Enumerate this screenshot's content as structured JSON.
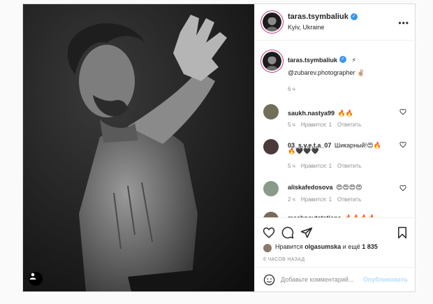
{
  "post": {
    "username": "taras.tsymbaliuk",
    "location": "Kyiv, Ukraine",
    "caption": {
      "username": "taras.tsymbaliuk",
      "emoji": "⚡",
      "text": "@zubarev.photographer ✌🏼",
      "time": "6 ч"
    },
    "comments": [
      {
        "username": "saukh.nastya99",
        "text": "🔥🔥",
        "time": "5 ч",
        "likes": "Нравится: 1",
        "reply": "Ответить"
      },
      {
        "username": "03_s.v.e.t.a_07",
        "text": "Шикарный!😍🔥",
        "text2": "🔥🖤🖤🖤",
        "time": "5 ч",
        "likes": "Нравится: 1",
        "reply": "Ответить"
      },
      {
        "username": "aliskafedosova",
        "text": "😍😍😍😍",
        "time": "2 ч",
        "likes": "Нравится: 1",
        "reply": "Ответить"
      },
      {
        "username": "mashnovtstatiana",
        "text": "🔥🔥🔥🔥"
      }
    ],
    "liked_by": {
      "prefix": "Нравится",
      "user": "olgasumska",
      "middle": "и ещё",
      "count": "1 835"
    },
    "time_ago": "6 ЧАСОВ НАЗАД",
    "comment_input": {
      "placeholder": "Добавьте комментарий...",
      "post_label": "Опубликовать"
    }
  },
  "icons": [
    "more-icon",
    "heart-icon",
    "comment-icon",
    "share-icon",
    "bookmark-icon",
    "emoji-icon",
    "user-tag-icon",
    "verified-icon"
  ],
  "colors": {
    "verified": "#3897f0",
    "post_button_disabled": "#b2dffc",
    "meta": "#8e8e8e"
  }
}
